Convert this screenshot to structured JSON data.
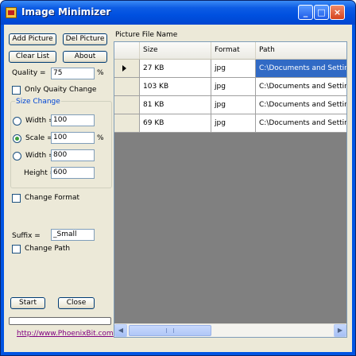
{
  "window": {
    "title": "Image Minimizer",
    "controls": {
      "minimize": "_",
      "maximize": "□",
      "close": "×"
    }
  },
  "buttons": {
    "add_picture": "Add Picture",
    "del_picture": "Del Picture",
    "clear_list": "Clear List",
    "about": "About",
    "start": "Start",
    "close": "Close"
  },
  "quality": {
    "label": "Quality =",
    "value": "75",
    "unit": "%",
    "only_change_label": "Only Quaity Change"
  },
  "size_change": {
    "title": "Size Change",
    "width_label": "Width =",
    "width_value": "100",
    "scale_label": "Scale =",
    "scale_value": "100",
    "scale_unit": "%",
    "width2_label": "Width =",
    "width2_value": "800",
    "height_label": "Height =",
    "height_value": "600",
    "selected": "scale"
  },
  "change_format_label": "Change Format",
  "suffix": {
    "label": "Suffix =",
    "value": "_Small"
  },
  "change_path_label": "Change Path",
  "link": "http://www.PhoenixBit.com",
  "list_title": "Picture File Name",
  "grid": {
    "columns": [
      "Size",
      "Format",
      "Path"
    ],
    "rows": [
      {
        "size": "27 KB",
        "format": "jpg",
        "path": "C:\\Documents and Settings",
        "current": true
      },
      {
        "size": "103 KB",
        "format": "jpg",
        "path": "C:\\Documents and Settings",
        "current": false
      },
      {
        "size": "81 KB",
        "format": "jpg",
        "path": "C:\\Documents and Settings",
        "current": false
      },
      {
        "size": "69 KB",
        "format": "jpg",
        "path": "C:\\Documents and Settings",
        "current": false
      }
    ]
  },
  "scrollbar": {
    "left_arrow": "◀",
    "right_arrow": "▶"
  },
  "colors": {
    "title_bar": "#0054e3",
    "selection": "#316ac5",
    "group_title": "#0046d5",
    "link": "#800080",
    "grid_background": "#808080"
  }
}
